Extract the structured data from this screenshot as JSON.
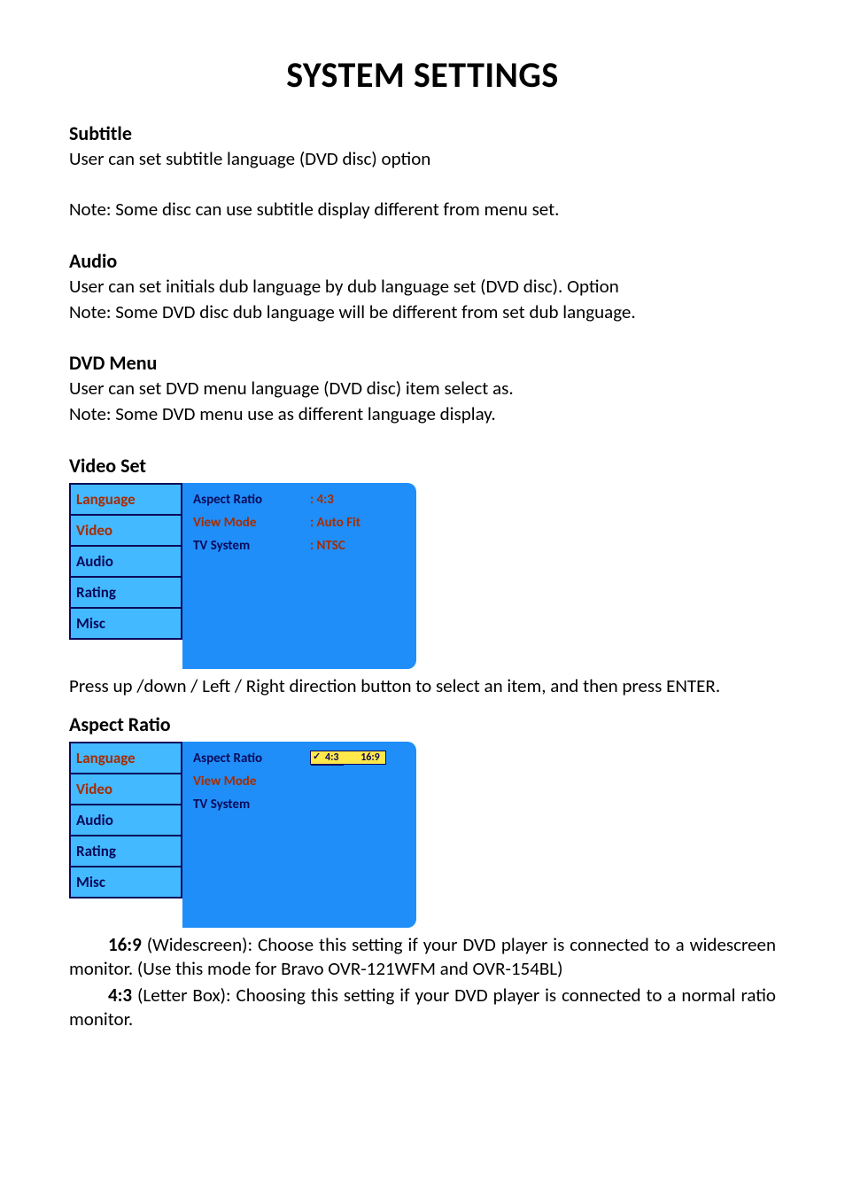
{
  "title": "SYSTEM SETTINGS",
  "sections": {
    "subtitle": {
      "heading": "Subtitle",
      "desc": "User can set subtitle language (DVD disc) option",
      "note": "Note: Some disc can use subtitle display different from menu set."
    },
    "audio": {
      "heading": "Audio",
      "desc": "User can set initials dub language by dub language set (DVD disc). Option",
      "note": "Note: Some DVD disc dub language will be different from set dub language."
    },
    "dvdmenu": {
      "heading": "DVD Menu",
      "desc": "User can set DVD menu language (DVD disc) item select as.",
      "note": "Note: Some DVD menu use as different language display."
    },
    "videoset": {
      "heading": "Video Set",
      "after": "Press up /down / Left / Right direction button to select an item, and then press ENTER."
    },
    "aspect": {
      "heading": "Aspect Ratio",
      "p1a": "16:9",
      "p1b": " (Widescreen): Choose this setting if your DVD player is connected to a widescreen monitor. (Use this mode for Bravo OVR-121WFM and OVR-154BL)",
      "p2a": "4:3",
      "p2b": "  (Letter Box): Choosing this setting if your DVD player is connected to a normal ratio monitor."
    }
  },
  "menu_tabs": [
    "Language",
    "Video",
    "Audio",
    "Rating",
    "Misc"
  ],
  "menu1_rows": [
    {
      "label": "Aspect Ratio",
      "value": ": 4:3"
    },
    {
      "label": "View Mode",
      "value": ": Auto Fit"
    },
    {
      "label": "TV System",
      "value": ": NTSC"
    }
  ],
  "menu2_rows": {
    "r1_label": "Aspect Ratio",
    "r2_label": "View Mode",
    "r3_label": "TV System",
    "options": [
      "4:3",
      "16:9"
    ]
  }
}
